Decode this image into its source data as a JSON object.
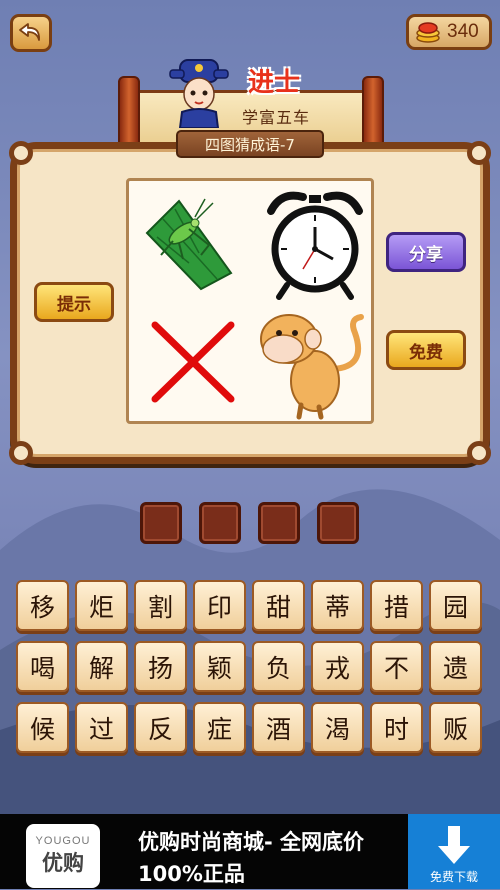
{
  "header": {
    "back_icon": "back-arrow-icon",
    "coin_icon": "coin-stack-icon",
    "coins": "340"
  },
  "banner": {
    "title": "进士",
    "subtitle": "学富五车",
    "level_label": "四图猜成语-7"
  },
  "puzzle": {
    "images": [
      "grasshopper-icon",
      "alarm-clock-icon",
      "red-cross-icon",
      "monkey-icon"
    ]
  },
  "buttons": {
    "hint": "提示",
    "share": "分享",
    "free": "免费"
  },
  "answer_slots": [
    "",
    "",
    "",
    ""
  ],
  "keyboard": [
    [
      "移",
      "炬",
      "割",
      "印",
      "甜",
      "蒂",
      "措",
      "园"
    ],
    [
      "喝",
      "解",
      "扬",
      "颖",
      "负",
      "戎",
      "不",
      "遗"
    ],
    [
      "候",
      "过",
      "反",
      "症",
      "酒",
      "渴",
      "时",
      "贩"
    ]
  ],
  "ad": {
    "logo_en": "YOUGOU",
    "logo_cn": "优购",
    "text": "优购时尚商城- 全网底价 100%正品",
    "download_label": "免费下载",
    "download_icon": "download-arrow-icon"
  },
  "colors": {
    "slot": "#7a2d1a",
    "board_border": "#7b3f17",
    "ad_download": "#1680d6"
  }
}
